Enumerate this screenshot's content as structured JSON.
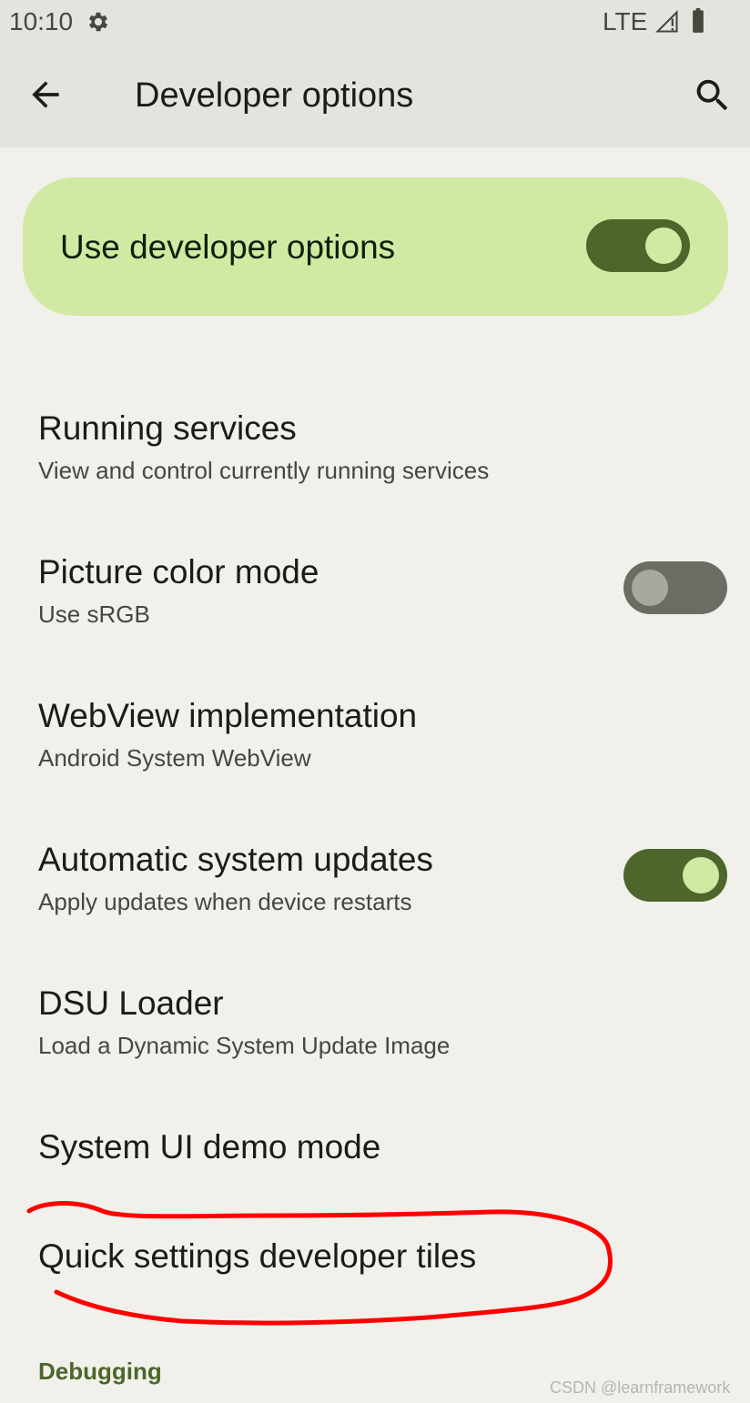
{
  "status_bar": {
    "time": "10:10",
    "network": "LTE",
    "icons": [
      "settings-gear-icon",
      "signal-icon",
      "battery-icon"
    ]
  },
  "app_bar": {
    "title": "Developer options",
    "back_icon": "arrow-back-icon",
    "search_icon": "search-icon"
  },
  "main_switch": {
    "label": "Use developer options",
    "enabled": true
  },
  "preferences": [
    {
      "title": "Running services",
      "summary": "View and control currently running services"
    },
    {
      "title": "Picture color mode",
      "summary": "Use sRGB",
      "toggle": false
    },
    {
      "title": "WebView implementation",
      "summary": "Android System WebView"
    },
    {
      "title": "Automatic system updates",
      "summary": "Apply updates when device restarts",
      "toggle": true
    },
    {
      "title": "DSU Loader",
      "summary": "Load a Dynamic System Update Image"
    },
    {
      "title": "System UI demo mode"
    },
    {
      "title": "Quick settings developer tiles"
    }
  ],
  "section_header": "Debugging",
  "watermark": "CSDN @learnframework",
  "colors": {
    "background": "#f1f0eb",
    "app_bar": "#e4e4de",
    "main_switch_bg": "#d1eaa3",
    "toggle_on_track": "#4c662b",
    "toggle_on_knob": "#d1eaa3",
    "toggle_off_track": "#6b6c64",
    "toggle_off_knob": "#a8a89f",
    "main_knob": "#d1eaa3",
    "accent": "#4c662b",
    "annotation": "#ff0000"
  }
}
